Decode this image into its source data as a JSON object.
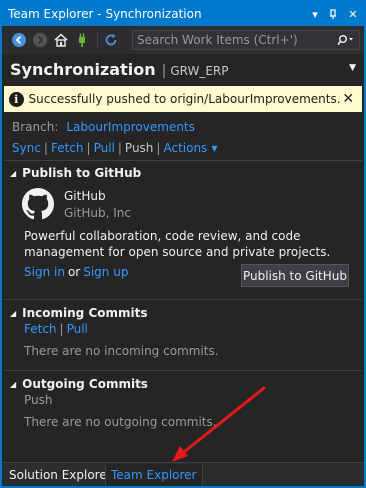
{
  "window": {
    "title": "Team Explorer - Synchronization",
    "controls": {
      "dropdown_icon": "▾",
      "pin_icon": "⊣",
      "close_icon": "✕"
    }
  },
  "toolbar": {
    "search_placeholder": "Search Work Items (Ctrl+')"
  },
  "header": {
    "title": "Synchronization",
    "divider": "|",
    "repo": "GRW_ERP"
  },
  "notification": {
    "message": "Successfully pushed to origin/LabourImprovements.",
    "icon": "i",
    "close": "✕"
  },
  "branch": {
    "label": "Branch:",
    "name": "LabourImprovements"
  },
  "nav": {
    "sync": "Sync",
    "fetch": "Fetch",
    "pull": "Pull",
    "push": "Push",
    "actions": "Actions",
    "separator": "|"
  },
  "publish_github": {
    "heading": "Publish to GitHub",
    "name": "GitHub",
    "company": "GitHub, Inc",
    "description": "Powerful collaboration, code review, and code management for open source and private projects.",
    "sign_in": "Sign in",
    "or": "or",
    "sign_up": "Sign up",
    "button": "Publish to GitHub"
  },
  "incoming": {
    "heading": "Incoming Commits",
    "fetch": "Fetch",
    "pull": "Pull",
    "empty": "There are no incoming commits."
  },
  "outgoing": {
    "heading": "Outgoing Commits",
    "push": "Push",
    "empty": "There are no outgoing commits."
  },
  "tabs": {
    "solution_explorer": "Solution Explorer",
    "team_explorer": "Team Explorer"
  },
  "colors": {
    "accent": "#007acc",
    "link": "#3399ff",
    "notice_bg": "#fffacd",
    "annotation_arrow": "#e51a1a"
  }
}
